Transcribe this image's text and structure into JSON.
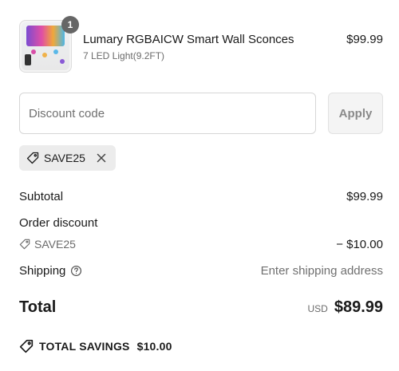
{
  "product": {
    "quantity_badge": "1",
    "name": "Lumary RGBAICW Smart Wall Sconces",
    "variant": "7 LED Light(9.2FT)",
    "price": "$99.99"
  },
  "discount": {
    "placeholder": "Discount code",
    "value": "",
    "apply_label": "Apply",
    "applied_code": "SAVE25"
  },
  "summary": {
    "subtotal_label": "Subtotal",
    "subtotal_value": "$99.99",
    "order_discount_label": "Order discount",
    "discount_code": "SAVE25",
    "discount_value": "− $10.00",
    "shipping_label": "Shipping",
    "shipping_value": "Enter shipping address",
    "total_label": "Total",
    "currency": "USD",
    "total_value": "$89.99",
    "savings_label": "TOTAL SAVINGS",
    "savings_value": "$10.00"
  },
  "icons": {
    "tag": "tag-icon",
    "remove": "close-icon",
    "help": "help-circle-icon"
  },
  "colors": {
    "badge": "#666666",
    "chip_bg": "#ececec",
    "muted_text": "#707070",
    "apply_button_bg": "#f4f4f4"
  }
}
